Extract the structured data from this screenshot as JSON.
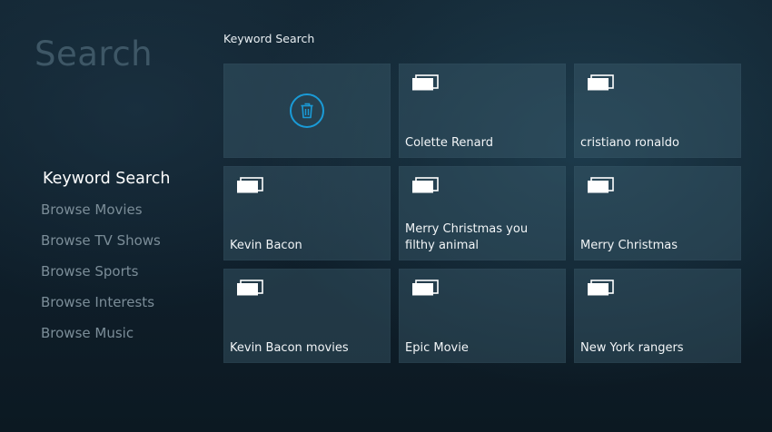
{
  "page": {
    "title": "Search"
  },
  "section": {
    "heading": "Keyword Search"
  },
  "sidebar": {
    "items": [
      {
        "label": "Keyword Search",
        "active": true
      },
      {
        "label": "Browse Movies",
        "active": false
      },
      {
        "label": "Browse TV Shows",
        "active": false
      },
      {
        "label": "Browse Sports",
        "active": false
      },
      {
        "label": "Browse Interests",
        "active": false
      },
      {
        "label": "Browse Music",
        "active": false
      }
    ]
  },
  "grid": {
    "delete_tile": {
      "icon": "trash-icon"
    },
    "tiles": [
      {
        "label": "Colette Renard",
        "icon": "stacked-cards-icon"
      },
      {
        "label": "cristiano ronaldo",
        "icon": "stacked-cards-icon"
      },
      {
        "label": "Kevin Bacon",
        "icon": "stacked-cards-icon"
      },
      {
        "label": "Merry Christmas you filthy animal",
        "icon": "stacked-cards-icon"
      },
      {
        "label": "Merry Christmas",
        "icon": "stacked-cards-icon"
      },
      {
        "label": "Kevin Bacon movies",
        "icon": "stacked-cards-icon"
      },
      {
        "label": "Epic Movie",
        "icon": "stacked-cards-icon"
      },
      {
        "label": "New York rangers",
        "icon": "stacked-cards-icon"
      }
    ]
  },
  "colors": {
    "accent": "#1a9bd7",
    "title_dim": "#3e5766",
    "sidebar_inactive": "#7b8d98",
    "tile_bg": "#2f4d5c"
  }
}
